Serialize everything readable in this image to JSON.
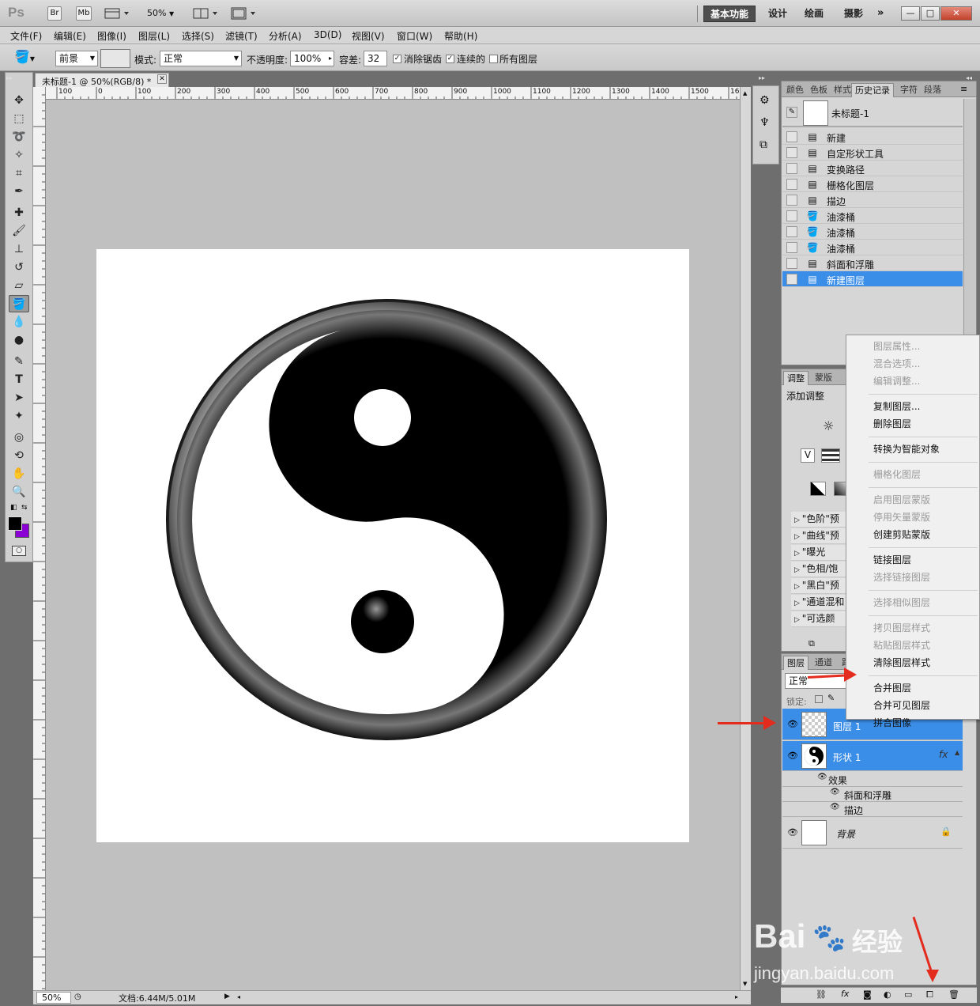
{
  "app": {
    "logo": "Ps",
    "bridge": "Br",
    "mini_bridge": "Mb",
    "zoom": "50%"
  },
  "workspaces": [
    "基本功能",
    "设计",
    "绘画",
    "摄影"
  ],
  "window_buttons": [
    "—",
    "□",
    "✕"
  ],
  "menu": [
    "文件(F)",
    "编辑(E)",
    "图像(I)",
    "图层(L)",
    "选择(S)",
    "滤镜(T)",
    "分析(A)",
    "3D(D)",
    "视图(V)",
    "窗口(W)",
    "帮助(H)"
  ],
  "options": {
    "fill_source": "前景",
    "mode_label": "模式:",
    "mode_value": "正常",
    "opacity_label": "不透明度:",
    "opacity_value": "100%",
    "tolerance_label": "容差:",
    "tolerance_value": "32",
    "antialias": "消除锯齿",
    "contiguous": "连续的",
    "all_layers": "所有图层"
  },
  "document": {
    "tab_title": "未标题-1 @ 50%(RGB/8) *",
    "ruler_ticks": [
      "100",
      "0",
      "100",
      "200",
      "300",
      "400",
      "500",
      "600",
      "700",
      "800",
      "900",
      "1000",
      "1100",
      "1200",
      "1300",
      "1400",
      "1500",
      "160"
    ],
    "status_zoom": "50%",
    "status_doc": "文档:6.44M/5.01M"
  },
  "colors": {
    "foreground": "#000000",
    "background": "#8a00d4",
    "highlight": "#3b8ee8",
    "arrow": "#e32b1e"
  },
  "history_panel": {
    "tabs": [
      "颜色",
      "色板",
      "样式",
      "历史记录",
      "字符",
      "段落"
    ],
    "snapshot": "未标题-1",
    "items": [
      {
        "label": "新建",
        "icon": "doc-icon"
      },
      {
        "label": "自定形状工具",
        "icon": "doc-icon"
      },
      {
        "label": "变换路径",
        "icon": "doc-icon"
      },
      {
        "label": "栅格化图层",
        "icon": "doc-icon"
      },
      {
        "label": "描边",
        "icon": "doc-icon"
      },
      {
        "label": "油漆桶",
        "icon": "bucket-icon"
      },
      {
        "label": "油漆桶",
        "icon": "bucket-icon"
      },
      {
        "label": "油漆桶",
        "icon": "bucket-icon"
      },
      {
        "label": "斜面和浮雕",
        "icon": "doc-icon"
      },
      {
        "label": "新建图层",
        "icon": "doc-icon"
      }
    ],
    "selected_index": 9
  },
  "adjust_panel": {
    "tabs": [
      "调整",
      "蒙版"
    ],
    "title": "添加调整",
    "presets": [
      "\"色阶\"预设",
      "\"曲线\"预设",
      "\"曝光度\"预设",
      "\"色相/饱和度\"预设",
      "\"黑白\"预设",
      "\"通道混和器\"预设",
      "\"可选颜色\"预设"
    ]
  },
  "layers_panel": {
    "tabs": [
      "图层",
      "通道",
      "路径"
    ],
    "blend_mode": "正常",
    "lock_label": "锁定:",
    "layers": [
      {
        "name": "图层 1",
        "selected": true
      },
      {
        "name": "形状 1",
        "selected": true,
        "fx": "fx"
      },
      {
        "name": "背景",
        "selected": false
      }
    ],
    "effects_label": "效果",
    "effects": [
      "斜面和浮雕",
      "描边"
    ]
  },
  "context_menu": {
    "groups": [
      [
        {
          "label": "图层属性...",
          "enabled": false
        },
        {
          "label": "混合选项...",
          "enabled": false
        },
        {
          "label": "编辑调整...",
          "enabled": false
        }
      ],
      [
        {
          "label": "复制图层...",
          "enabled": true
        },
        {
          "label": "删除图层",
          "enabled": true
        }
      ],
      [
        {
          "label": "转换为智能对象",
          "enabled": true
        }
      ],
      [
        {
          "label": "栅格化图层",
          "enabled": false
        }
      ],
      [
        {
          "label": "启用图层蒙版",
          "enabled": false
        },
        {
          "label": "停用矢量蒙版",
          "enabled": false
        },
        {
          "label": "创建剪贴蒙版",
          "enabled": true
        }
      ],
      [
        {
          "label": "链接图层",
          "enabled": true
        },
        {
          "label": "选择链接图层",
          "enabled": false
        }
      ],
      [
        {
          "label": "选择相似图层",
          "enabled": false
        }
      ],
      [
        {
          "label": "拷贝图层样式",
          "enabled": false
        },
        {
          "label": "粘贴图层样式",
          "enabled": false
        },
        {
          "label": "清除图层样式",
          "enabled": true
        }
      ],
      [
        {
          "label": "合并图层",
          "enabled": true
        },
        {
          "label": "合并可见图层",
          "enabled": true
        },
        {
          "label": "拼合图像",
          "enabled": true
        }
      ]
    ]
  },
  "watermark": {
    "brand": "Bai",
    "brand2": "经验",
    "url": "jingyan.baidu.com"
  }
}
